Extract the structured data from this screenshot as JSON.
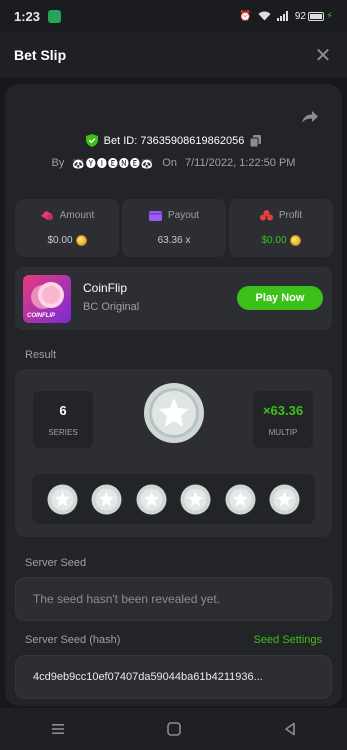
{
  "status_bar": {
    "time": "1:23",
    "battery": "92"
  },
  "header": {
    "title": "Bet Slip"
  },
  "bet": {
    "id_label": "Bet ID: 73635908619862056",
    "by_label": "By",
    "user": "🐼🅨🅘🅔🅝🅔🐼",
    "on_label": "On",
    "datetime": "7/11/2022, 1:22:50 PM"
  },
  "stats": [
    {
      "label": "Amount",
      "value": "$0.00"
    },
    {
      "label": "Payout",
      "value": "63.36 x"
    },
    {
      "label": "Profit",
      "value": "$0.00"
    }
  ],
  "game": {
    "thumb_label": "COINFLIP",
    "name": "CoinFlip",
    "subtitle": "BC Original",
    "play_label": "Play Now"
  },
  "result": {
    "section_label": "Result",
    "series_value": "6",
    "series_label": "SERIES",
    "multiplier_value": "×63.36",
    "multiplier_label": "MULTIP"
  },
  "server_seed": {
    "label": "Server Seed",
    "placeholder": "The seed hasn't been revealed yet."
  },
  "server_seed_hash": {
    "label": "Server Seed (hash)",
    "link": "Seed Settings",
    "value": "4cd9eb9cc10ef07407da59044ba61b4211936..."
  },
  "colors": {
    "accent": "#3bc117",
    "background": "#17181b",
    "card": "#2c2e33"
  }
}
